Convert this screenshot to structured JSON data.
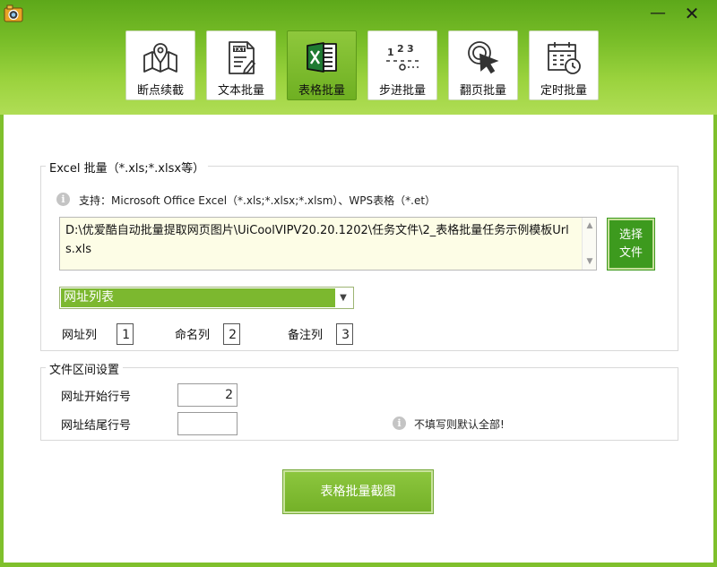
{
  "window": {
    "app_icon": "camera-icon",
    "minimize_label": "—",
    "close_label": "✕"
  },
  "toolbar": {
    "items": [
      {
        "label": "断点续截",
        "icon": "map-pin-icon",
        "active": false
      },
      {
        "label": "文本批量",
        "icon": "txt-file-icon",
        "active": false
      },
      {
        "label": "表格批量",
        "icon": "excel-icon",
        "active": true
      },
      {
        "label": "步进批量",
        "icon": "step-numbers-icon",
        "active": false
      },
      {
        "label": "翻页批量",
        "icon": "cursor-click-icon",
        "active": false
      },
      {
        "label": "定时批量",
        "icon": "calendar-clock-icon",
        "active": false
      }
    ]
  },
  "excel_group": {
    "title": "Excel 批量（*.xls;*.xlsx等）",
    "info_icon": "i",
    "support_text": "支持：Microsoft Office Excel（*.xls;*.xlsx;*.xlsm）、WPS表格（*.et）",
    "file_path": "D:\\优爱酷自动批量提取网页图片\\UiCoolVIPV20.20.1202\\任务文件\\2_表格批量任务示例模板Urls.xls",
    "choose_button_line1": "选择",
    "choose_button_line2": "文件",
    "sheet_select_value": "网址列表",
    "url_col_label": "网址列",
    "url_col_value": "1",
    "name_col_label": "命名列",
    "name_col_value": "2",
    "note_col_label": "备注列",
    "note_col_value": "3"
  },
  "range_group": {
    "title": "文件区间设置",
    "start_row_label": "网址开始行号",
    "start_row_value": "2",
    "end_row_label": "网址结尾行号",
    "end_row_value": "",
    "hint": "不填写则默认全部!"
  },
  "action": {
    "capture_button": "表格批量截图"
  },
  "colors": {
    "brand_green": "#7cb82f",
    "dark_green": "#3d9a1e",
    "path_bg": "#fdfde6"
  }
}
